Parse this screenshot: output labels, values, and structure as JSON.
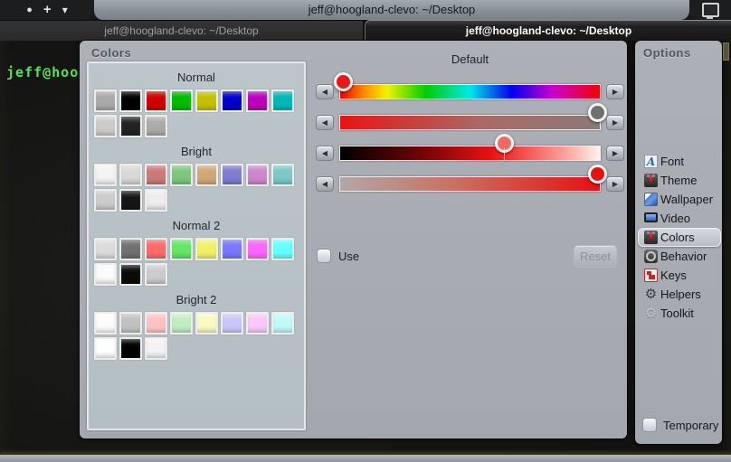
{
  "window": {
    "title": "jeff@hoogland-clevo: ~/Desktop",
    "controls": {
      "close": "●",
      "add": "+",
      "menu": "▾"
    }
  },
  "tabs": [
    {
      "label": "jeff@hoogland-clevo: ~/Desktop",
      "active": false
    },
    {
      "label": "jeff@hoogland-clevo: ~/Desktop",
      "active": true
    }
  ],
  "terminal": {
    "visible_text": "jeff@hoog",
    "text_color": "#58e058"
  },
  "colors_panel": {
    "title": "Colors",
    "sections": [
      {
        "title": "Normal",
        "rows": [
          [
            "#aaaaaa",
            "#000000",
            "#cc0000",
            "#00bb00",
            "#c2c200",
            "#0000cc",
            "#bb00bb",
            "#00b7b7"
          ],
          [
            "#cccccc",
            "#222222",
            "#ababab"
          ]
        ]
      },
      {
        "title": "Bright",
        "rows": [
          [
            "#f4f4f4",
            "#d8d8d8",
            "#cc7878",
            "#7cc87c",
            "#d0a878",
            "#7c7cd0",
            "#cc88cc",
            "#7cc8c8"
          ],
          [
            "#cccccc",
            "#151515",
            "#ededed"
          ]
        ]
      },
      {
        "title": "Normal 2",
        "rows": [
          [
            "#dcdcdc",
            "#707070",
            "#ff6a6a",
            "#66e566",
            "#f2f266",
            "#7878ff",
            "#ff66ff",
            "#66ffff"
          ],
          [
            "#fbfbfb",
            "#0b0b0b",
            "#cccccc"
          ]
        ]
      },
      {
        "title": "Bright 2",
        "rows": [
          [
            "#fcfcfc",
            "#c2c2c2",
            "#ffc2c2",
            "#c2eec2",
            "#fafac2",
            "#c8c8fa",
            "#fac8fa",
            "#c2fafa"
          ],
          [
            "#ffffff",
            "#000000",
            "#f3f3f3"
          ]
        ]
      }
    ]
  },
  "default_panel": {
    "title": "Default",
    "arrow_left": "◀",
    "arrow_right": "▶",
    "sliders": [
      {
        "name": "hue",
        "gradient": "g-hue",
        "value_percent": 1,
        "knob_color": "#e81818",
        "stem": false
      },
      {
        "name": "saturation",
        "gradient": "g-sat",
        "value_percent": 99,
        "knob_color": "#6f6f6f",
        "stem": false
      },
      {
        "name": "lightness",
        "gradient": "g-light",
        "value_percent": 63,
        "knob_color": "#f26a62",
        "stem": true
      },
      {
        "name": "alpha",
        "gradient": "g-alpha",
        "value_percent": 99,
        "knob_color": "#e81010",
        "stem": false
      }
    ],
    "use_checkbox": {
      "label": "Use",
      "checked": false
    },
    "reset_button": {
      "label": "Reset",
      "enabled": false
    }
  },
  "options_panel": {
    "title": "Options",
    "items": [
      {
        "label": "Font",
        "icon": "font-icon",
        "icon_class": "i-font",
        "glyph": "A",
        "selected": false
      },
      {
        "label": "Theme",
        "icon": "theme-suit-icon",
        "icon_class": "i-suit",
        "glyph": "",
        "selected": false
      },
      {
        "label": "Wallpaper",
        "icon": "wallpaper-icon",
        "icon_class": "i-wall",
        "glyph": "",
        "selected": false
      },
      {
        "label": "Video",
        "icon": "video-monitor-icon",
        "icon_class": "i-video",
        "glyph": "",
        "selected": false
      },
      {
        "label": "Colors",
        "icon": "colors-suit-icon",
        "icon_class": "i-suit",
        "glyph": "",
        "selected": true
      },
      {
        "label": "Behavior",
        "icon": "behavior-dial-icon",
        "icon_class": "i-behavior",
        "glyph": "",
        "selected": false
      },
      {
        "label": "Keys",
        "icon": "keys-keyboard-icon",
        "icon_class": "i-keys",
        "glyph": "",
        "selected": false
      },
      {
        "label": "Helpers",
        "icon": "helpers-gear-icon",
        "icon_class": "i-gear",
        "glyph": "⚙",
        "selected": false
      },
      {
        "label": "Toolkit",
        "icon": "toolkit-gear-icon",
        "icon_class": "i-gear-faded",
        "glyph": "⚙",
        "selected": false
      }
    ],
    "temporary_checkbox": {
      "label": "Temporary",
      "checked": false
    }
  }
}
